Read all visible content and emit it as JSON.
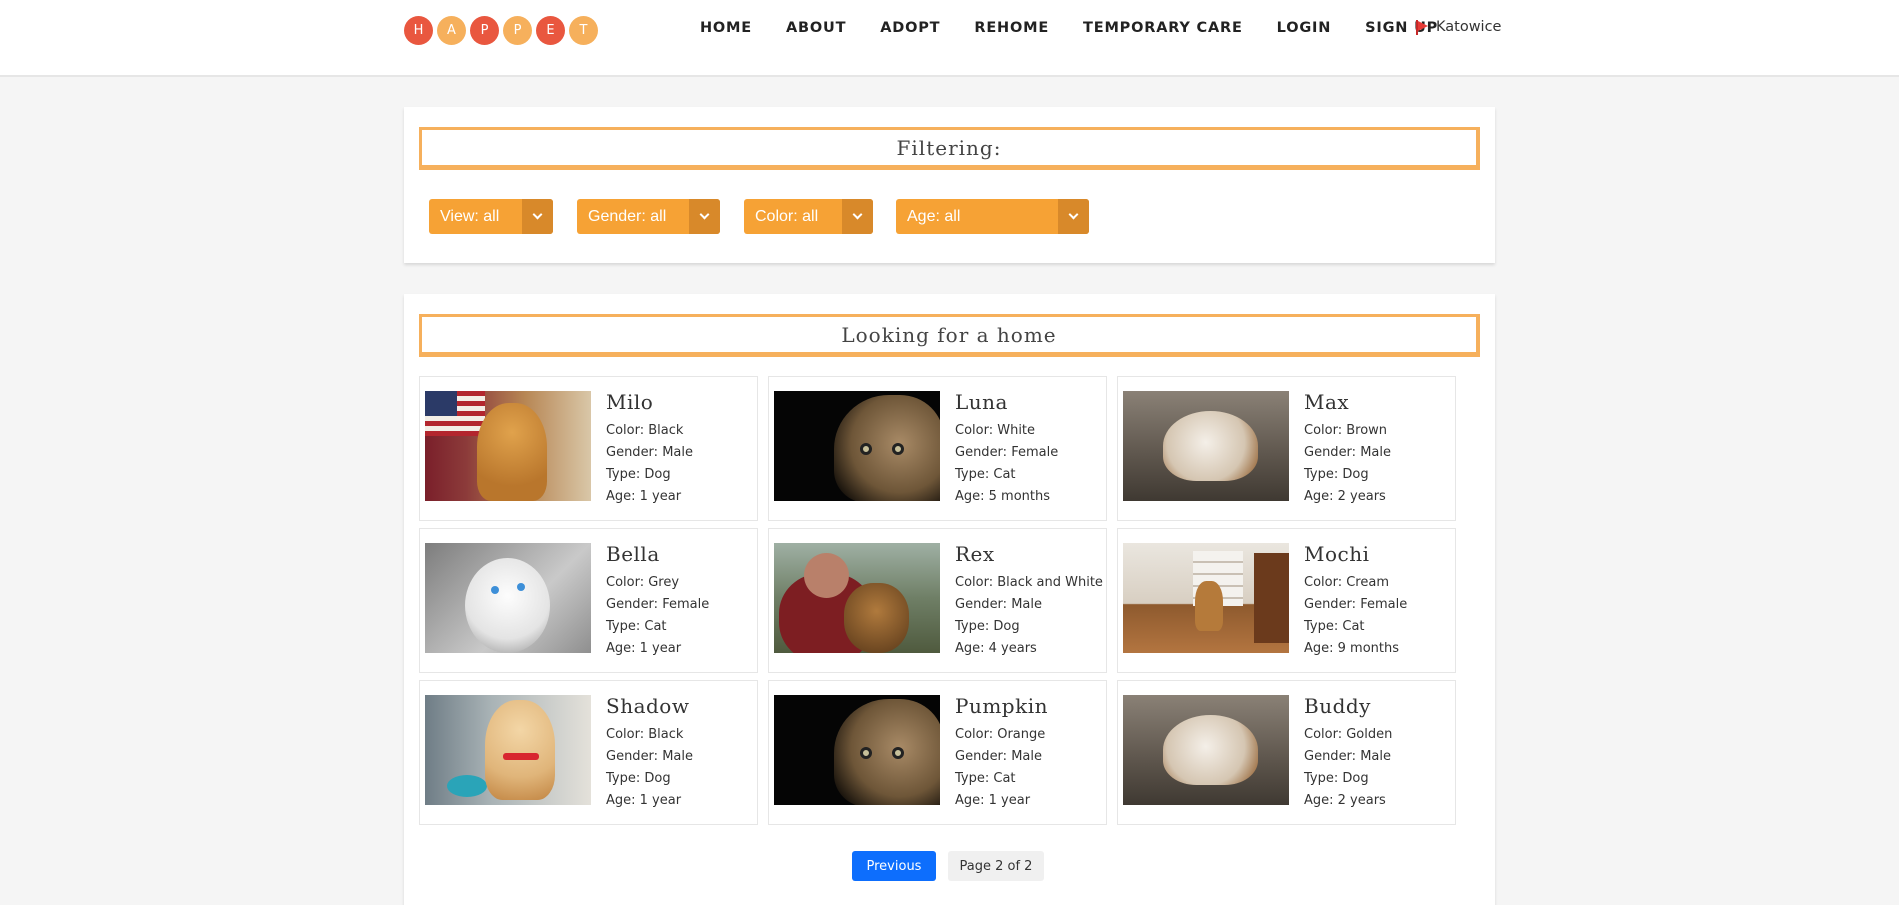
{
  "header": {
    "logo_letters": [
      "H",
      "A",
      "P",
      "P",
      "E",
      "T"
    ],
    "nav": [
      "HOME",
      "ABOUT",
      "ADOPT",
      "REHOME",
      "TEMPORARY CARE",
      "LOGIN",
      "SIGN UP"
    ],
    "location": "Katowice"
  },
  "filters": {
    "title": "Filtering:",
    "view": "View: all",
    "gender": "Gender: all",
    "color": "Color: all",
    "age": "Age: all"
  },
  "listing": {
    "title": "Looking for a home",
    "pets": [
      {
        "name": "Milo",
        "color": "Color: Black",
        "gender": "Gender: Male",
        "type": "Type: Dog",
        "age": "Age: 1 year"
      },
      {
        "name": "Luna",
        "color": "Color: White",
        "gender": "Gender: Female",
        "type": "Type: Cat",
        "age": "Age: 5 months"
      },
      {
        "name": "Max",
        "color": "Color: Brown",
        "gender": "Gender: Male",
        "type": "Type: Dog",
        "age": "Age: 2 years"
      },
      {
        "name": "Bella",
        "color": "Color: Grey",
        "gender": "Gender: Female",
        "type": "Type: Cat",
        "age": "Age: 1 year"
      },
      {
        "name": "Rex",
        "color": "Color: Black and White",
        "gender": "Gender: Male",
        "type": "Type: Dog",
        "age": "Age: 4 years"
      },
      {
        "name": "Mochi",
        "color": "Color: Cream",
        "gender": "Gender: Female",
        "type": "Type: Cat",
        "age": "Age: 9 months"
      },
      {
        "name": "Shadow",
        "color": "Color: Black",
        "gender": "Gender: Male",
        "type": "Type: Dog",
        "age": "Age: 1 year"
      },
      {
        "name": "Pumpkin",
        "color": "Color: Orange",
        "gender": "Gender: Male",
        "type": "Type: Cat",
        "age": "Age: 1 year"
      },
      {
        "name": "Buddy",
        "color": "Color: Golden",
        "gender": "Gender: Male",
        "type": "Type: Dog",
        "age": "Age: 2 years"
      }
    ]
  },
  "pagination": {
    "previous": "Previous",
    "page_info": "Page 2 of 2"
  },
  "colors": {
    "accent": "#f6a235",
    "accent_dark": "#d8892a",
    "logo_red": "#e9573f",
    "logo_orange": "#f6b05c",
    "primary_button": "#0d6efd"
  }
}
